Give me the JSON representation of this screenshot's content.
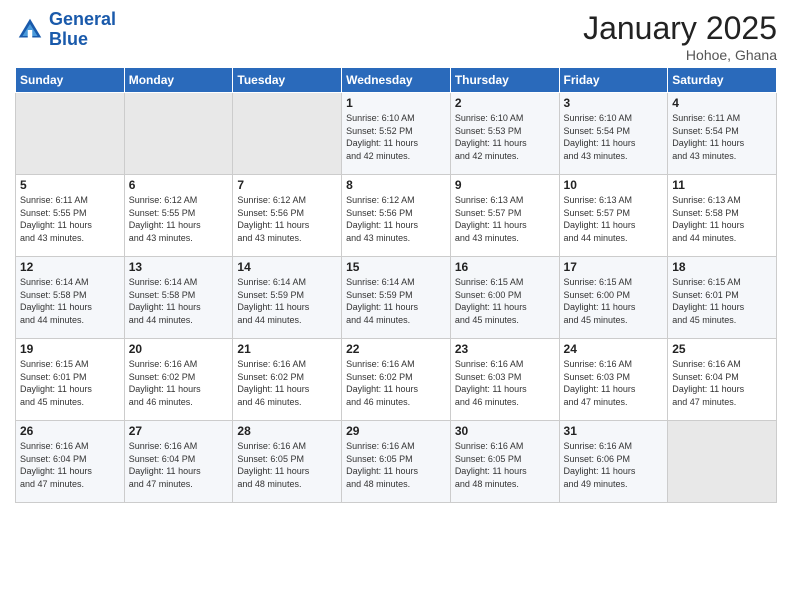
{
  "header": {
    "logo_line1": "General",
    "logo_line2": "Blue",
    "month": "January 2025",
    "location": "Hohoe, Ghana"
  },
  "weekdays": [
    "Sunday",
    "Monday",
    "Tuesday",
    "Wednesday",
    "Thursday",
    "Friday",
    "Saturday"
  ],
  "weeks": [
    [
      {
        "day": "",
        "info": ""
      },
      {
        "day": "",
        "info": ""
      },
      {
        "day": "",
        "info": ""
      },
      {
        "day": "1",
        "info": "Sunrise: 6:10 AM\nSunset: 5:52 PM\nDaylight: 11 hours\nand 42 minutes."
      },
      {
        "day": "2",
        "info": "Sunrise: 6:10 AM\nSunset: 5:53 PM\nDaylight: 11 hours\nand 42 minutes."
      },
      {
        "day": "3",
        "info": "Sunrise: 6:10 AM\nSunset: 5:54 PM\nDaylight: 11 hours\nand 43 minutes."
      },
      {
        "day": "4",
        "info": "Sunrise: 6:11 AM\nSunset: 5:54 PM\nDaylight: 11 hours\nand 43 minutes."
      }
    ],
    [
      {
        "day": "5",
        "info": "Sunrise: 6:11 AM\nSunset: 5:55 PM\nDaylight: 11 hours\nand 43 minutes."
      },
      {
        "day": "6",
        "info": "Sunrise: 6:12 AM\nSunset: 5:55 PM\nDaylight: 11 hours\nand 43 minutes."
      },
      {
        "day": "7",
        "info": "Sunrise: 6:12 AM\nSunset: 5:56 PM\nDaylight: 11 hours\nand 43 minutes."
      },
      {
        "day": "8",
        "info": "Sunrise: 6:12 AM\nSunset: 5:56 PM\nDaylight: 11 hours\nand 43 minutes."
      },
      {
        "day": "9",
        "info": "Sunrise: 6:13 AM\nSunset: 5:57 PM\nDaylight: 11 hours\nand 43 minutes."
      },
      {
        "day": "10",
        "info": "Sunrise: 6:13 AM\nSunset: 5:57 PM\nDaylight: 11 hours\nand 44 minutes."
      },
      {
        "day": "11",
        "info": "Sunrise: 6:13 AM\nSunset: 5:58 PM\nDaylight: 11 hours\nand 44 minutes."
      }
    ],
    [
      {
        "day": "12",
        "info": "Sunrise: 6:14 AM\nSunset: 5:58 PM\nDaylight: 11 hours\nand 44 minutes."
      },
      {
        "day": "13",
        "info": "Sunrise: 6:14 AM\nSunset: 5:58 PM\nDaylight: 11 hours\nand 44 minutes."
      },
      {
        "day": "14",
        "info": "Sunrise: 6:14 AM\nSunset: 5:59 PM\nDaylight: 11 hours\nand 44 minutes."
      },
      {
        "day": "15",
        "info": "Sunrise: 6:14 AM\nSunset: 5:59 PM\nDaylight: 11 hours\nand 44 minutes."
      },
      {
        "day": "16",
        "info": "Sunrise: 6:15 AM\nSunset: 6:00 PM\nDaylight: 11 hours\nand 45 minutes."
      },
      {
        "day": "17",
        "info": "Sunrise: 6:15 AM\nSunset: 6:00 PM\nDaylight: 11 hours\nand 45 minutes."
      },
      {
        "day": "18",
        "info": "Sunrise: 6:15 AM\nSunset: 6:01 PM\nDaylight: 11 hours\nand 45 minutes."
      }
    ],
    [
      {
        "day": "19",
        "info": "Sunrise: 6:15 AM\nSunset: 6:01 PM\nDaylight: 11 hours\nand 45 minutes."
      },
      {
        "day": "20",
        "info": "Sunrise: 6:16 AM\nSunset: 6:02 PM\nDaylight: 11 hours\nand 46 minutes."
      },
      {
        "day": "21",
        "info": "Sunrise: 6:16 AM\nSunset: 6:02 PM\nDaylight: 11 hours\nand 46 minutes."
      },
      {
        "day": "22",
        "info": "Sunrise: 6:16 AM\nSunset: 6:02 PM\nDaylight: 11 hours\nand 46 minutes."
      },
      {
        "day": "23",
        "info": "Sunrise: 6:16 AM\nSunset: 6:03 PM\nDaylight: 11 hours\nand 46 minutes."
      },
      {
        "day": "24",
        "info": "Sunrise: 6:16 AM\nSunset: 6:03 PM\nDaylight: 11 hours\nand 47 minutes."
      },
      {
        "day": "25",
        "info": "Sunrise: 6:16 AM\nSunset: 6:04 PM\nDaylight: 11 hours\nand 47 minutes."
      }
    ],
    [
      {
        "day": "26",
        "info": "Sunrise: 6:16 AM\nSunset: 6:04 PM\nDaylight: 11 hours\nand 47 minutes."
      },
      {
        "day": "27",
        "info": "Sunrise: 6:16 AM\nSunset: 6:04 PM\nDaylight: 11 hours\nand 47 minutes."
      },
      {
        "day": "28",
        "info": "Sunrise: 6:16 AM\nSunset: 6:05 PM\nDaylight: 11 hours\nand 48 minutes."
      },
      {
        "day": "29",
        "info": "Sunrise: 6:16 AM\nSunset: 6:05 PM\nDaylight: 11 hours\nand 48 minutes."
      },
      {
        "day": "30",
        "info": "Sunrise: 6:16 AM\nSunset: 6:05 PM\nDaylight: 11 hours\nand 48 minutes."
      },
      {
        "day": "31",
        "info": "Sunrise: 6:16 AM\nSunset: 6:06 PM\nDaylight: 11 hours\nand 49 minutes."
      },
      {
        "day": "",
        "info": ""
      }
    ]
  ]
}
